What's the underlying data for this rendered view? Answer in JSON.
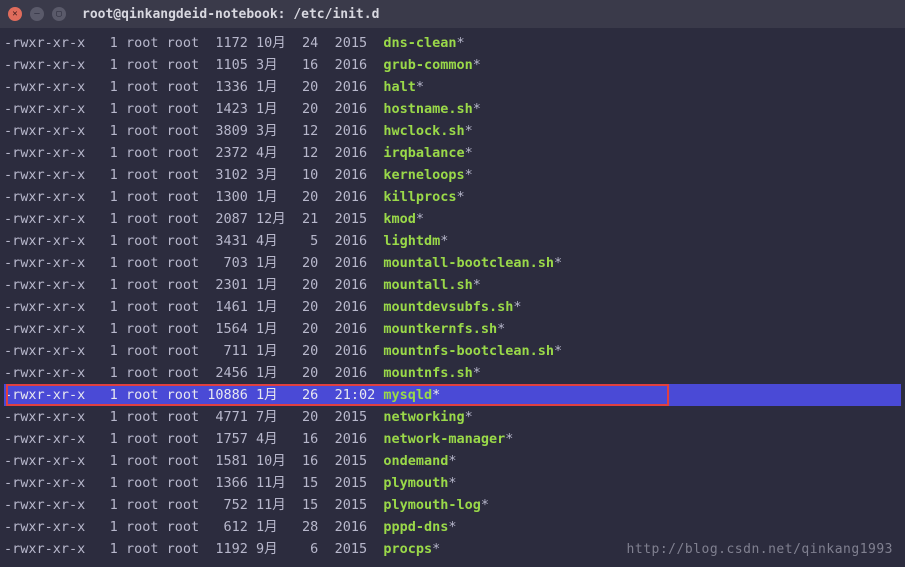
{
  "window": {
    "title": "root@qinkangdeid-notebook: /etc/init.d"
  },
  "watermark": "http://blog.csdn.net/qinkang1993",
  "rows": [
    {
      "perm": "-rwxr-xr-x",
      "links": "1",
      "owner": "root",
      "group": "root",
      "size": "1172",
      "month": "10月",
      "day": "24",
      "year": "2015",
      "name": "dns-clean",
      "star": "*",
      "hl": false
    },
    {
      "perm": "-rwxr-xr-x",
      "links": "1",
      "owner": "root",
      "group": "root",
      "size": "1105",
      "month": "3月",
      "day": "16",
      "year": "2016",
      "name": "grub-common",
      "star": "*",
      "hl": false
    },
    {
      "perm": "-rwxr-xr-x",
      "links": "1",
      "owner": "root",
      "group": "root",
      "size": "1336",
      "month": "1月",
      "day": "20",
      "year": "2016",
      "name": "halt",
      "star": "*",
      "hl": false
    },
    {
      "perm": "-rwxr-xr-x",
      "links": "1",
      "owner": "root",
      "group": "root",
      "size": "1423",
      "month": "1月",
      "day": "20",
      "year": "2016",
      "name": "hostname.sh",
      "star": "*",
      "hl": false
    },
    {
      "perm": "-rwxr-xr-x",
      "links": "1",
      "owner": "root",
      "group": "root",
      "size": "3809",
      "month": "3月",
      "day": "12",
      "year": "2016",
      "name": "hwclock.sh",
      "star": "*",
      "hl": false
    },
    {
      "perm": "-rwxr-xr-x",
      "links": "1",
      "owner": "root",
      "group": "root",
      "size": "2372",
      "month": "4月",
      "day": "12",
      "year": "2016",
      "name": "irqbalance",
      "star": "*",
      "hl": false
    },
    {
      "perm": "-rwxr-xr-x",
      "links": "1",
      "owner": "root",
      "group": "root",
      "size": "3102",
      "month": "3月",
      "day": "10",
      "year": "2016",
      "name": "kerneloops",
      "star": "*",
      "hl": false
    },
    {
      "perm": "-rwxr-xr-x",
      "links": "1",
      "owner": "root",
      "group": "root",
      "size": "1300",
      "month": "1月",
      "day": "20",
      "year": "2016",
      "name": "killprocs",
      "star": "*",
      "hl": false
    },
    {
      "perm": "-rwxr-xr-x",
      "links": "1",
      "owner": "root",
      "group": "root",
      "size": "2087",
      "month": "12月",
      "day": "21",
      "year": "2015",
      "name": "kmod",
      "star": "*",
      "hl": false
    },
    {
      "perm": "-rwxr-xr-x",
      "links": "1",
      "owner": "root",
      "group": "root",
      "size": "3431",
      "month": "4月",
      "day": "5",
      "year": "2016",
      "name": "lightdm",
      "star": "*",
      "hl": false
    },
    {
      "perm": "-rwxr-xr-x",
      "links": "1",
      "owner": "root",
      "group": "root",
      "size": "703",
      "month": "1月",
      "day": "20",
      "year": "2016",
      "name": "mountall-bootclean.sh",
      "star": "*",
      "hl": false
    },
    {
      "perm": "-rwxr-xr-x",
      "links": "1",
      "owner": "root",
      "group": "root",
      "size": "2301",
      "month": "1月",
      "day": "20",
      "year": "2016",
      "name": "mountall.sh",
      "star": "*",
      "hl": false
    },
    {
      "perm": "-rwxr-xr-x",
      "links": "1",
      "owner": "root",
      "group": "root",
      "size": "1461",
      "month": "1月",
      "day": "20",
      "year": "2016",
      "name": "mountdevsubfs.sh",
      "star": "*",
      "hl": false
    },
    {
      "perm": "-rwxr-xr-x",
      "links": "1",
      "owner": "root",
      "group": "root",
      "size": "1564",
      "month": "1月",
      "day": "20",
      "year": "2016",
      "name": "mountkernfs.sh",
      "star": "*",
      "hl": false
    },
    {
      "perm": "-rwxr-xr-x",
      "links": "1",
      "owner": "root",
      "group": "root",
      "size": "711",
      "month": "1月",
      "day": "20",
      "year": "2016",
      "name": "mountnfs-bootclean.sh",
      "star": "*",
      "hl": false
    },
    {
      "perm": "-rwxr-xr-x",
      "links": "1",
      "owner": "root",
      "group": "root",
      "size": "2456",
      "month": "1月",
      "day": "20",
      "year": "2016",
      "name": "mountnfs.sh",
      "star": "*",
      "hl": false
    },
    {
      "perm": "-rwxr-xr-x",
      "links": "1",
      "owner": "root",
      "group": "root",
      "size": "10886",
      "month": "1月",
      "day": "26",
      "year": "21:02",
      "name": "mysqld",
      "star": "*",
      "hl": true
    },
    {
      "perm": "-rwxr-xr-x",
      "links": "1",
      "owner": "root",
      "group": "root",
      "size": "4771",
      "month": "7月",
      "day": "20",
      "year": "2015",
      "name": "networking",
      "star": "*",
      "hl": false
    },
    {
      "perm": "-rwxr-xr-x",
      "links": "1",
      "owner": "root",
      "group": "root",
      "size": "1757",
      "month": "4月",
      "day": "16",
      "year": "2016",
      "name": "network-manager",
      "star": "*",
      "hl": false
    },
    {
      "perm": "-rwxr-xr-x",
      "links": "1",
      "owner": "root",
      "group": "root",
      "size": "1581",
      "month": "10月",
      "day": "16",
      "year": "2015",
      "name": "ondemand",
      "star": "*",
      "hl": false
    },
    {
      "perm": "-rwxr-xr-x",
      "links": "1",
      "owner": "root",
      "group": "root",
      "size": "1366",
      "month": "11月",
      "day": "15",
      "year": "2015",
      "name": "plymouth",
      "star": "*",
      "hl": false
    },
    {
      "perm": "-rwxr-xr-x",
      "links": "1",
      "owner": "root",
      "group": "root",
      "size": "752",
      "month": "11月",
      "day": "15",
      "year": "2015",
      "name": "plymouth-log",
      "star": "*",
      "hl": false
    },
    {
      "perm": "-rwxr-xr-x",
      "links": "1",
      "owner": "root",
      "group": "root",
      "size": "612",
      "month": "1月",
      "day": "28",
      "year": "2016",
      "name": "pppd-dns",
      "star": "*",
      "hl": false
    },
    {
      "perm": "-rwxr-xr-x",
      "links": "1",
      "owner": "root",
      "group": "root",
      "size": "1192",
      "month": "9月",
      "day": "6",
      "year": "2015",
      "name": "procps",
      "star": "*",
      "hl": false
    }
  ]
}
